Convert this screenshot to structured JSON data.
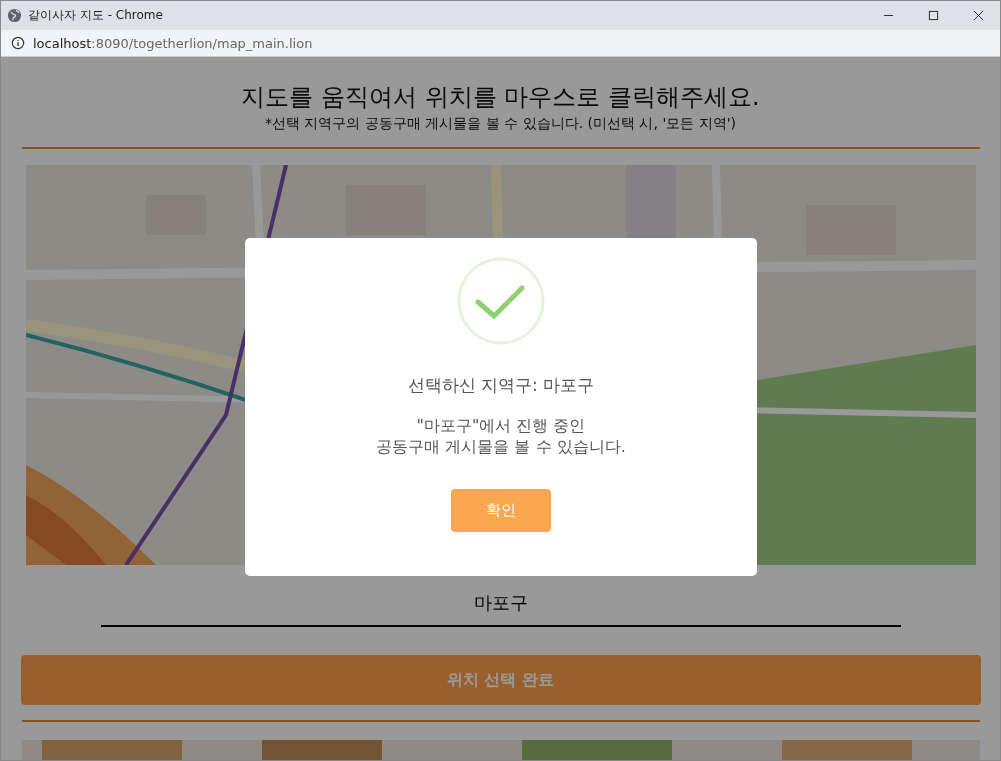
{
  "window": {
    "title": "같이사자 지도 - Chrome",
    "url_host": "localhost",
    "url_rest": ":8090/togetherlion/map_main.lion"
  },
  "page": {
    "heading": "지도를 움직여서 위치를 마우스로 클릭해주세요.",
    "note": "*선택 지역구의 공동구매 게시물을 볼 수 있습니다. (미선택 시, '모든 지역')",
    "selected_district": "마포구",
    "submit_button": "위치 선택 완료"
  },
  "dialog": {
    "open": true,
    "message": "선택하신 지역구: 마포구",
    "detail_lines": [
      "\"마포구\"에서 진행 중인",
      "공동구매 게시물을 볼 수 있습니다."
    ],
    "confirm_button": "확인"
  }
}
